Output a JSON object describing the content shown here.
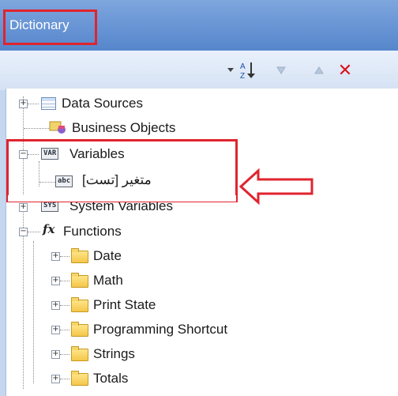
{
  "panel": {
    "title": "Dictionary"
  },
  "toolbar": {
    "sort_label": "A Z",
    "delete_glyph": "✕"
  },
  "tree": {
    "data_sources": "Data Sources",
    "business_objects": "Business Objects",
    "variables": "Variables",
    "variable_item": "متغیر [تست]",
    "system_variables": "System Variables",
    "functions": "Functions",
    "folders": [
      "Date",
      "Math",
      "Print State",
      "Programming Shortcut",
      "Strings",
      "Totals"
    ]
  },
  "icons": {
    "variables_tag": "VAR",
    "variable_item_tag": "abc",
    "system_variables_tag": "SYS",
    "functions_glyph": "fx"
  },
  "colors": {
    "title_bar": "#6b97d6",
    "highlight": "#e0242e"
  }
}
